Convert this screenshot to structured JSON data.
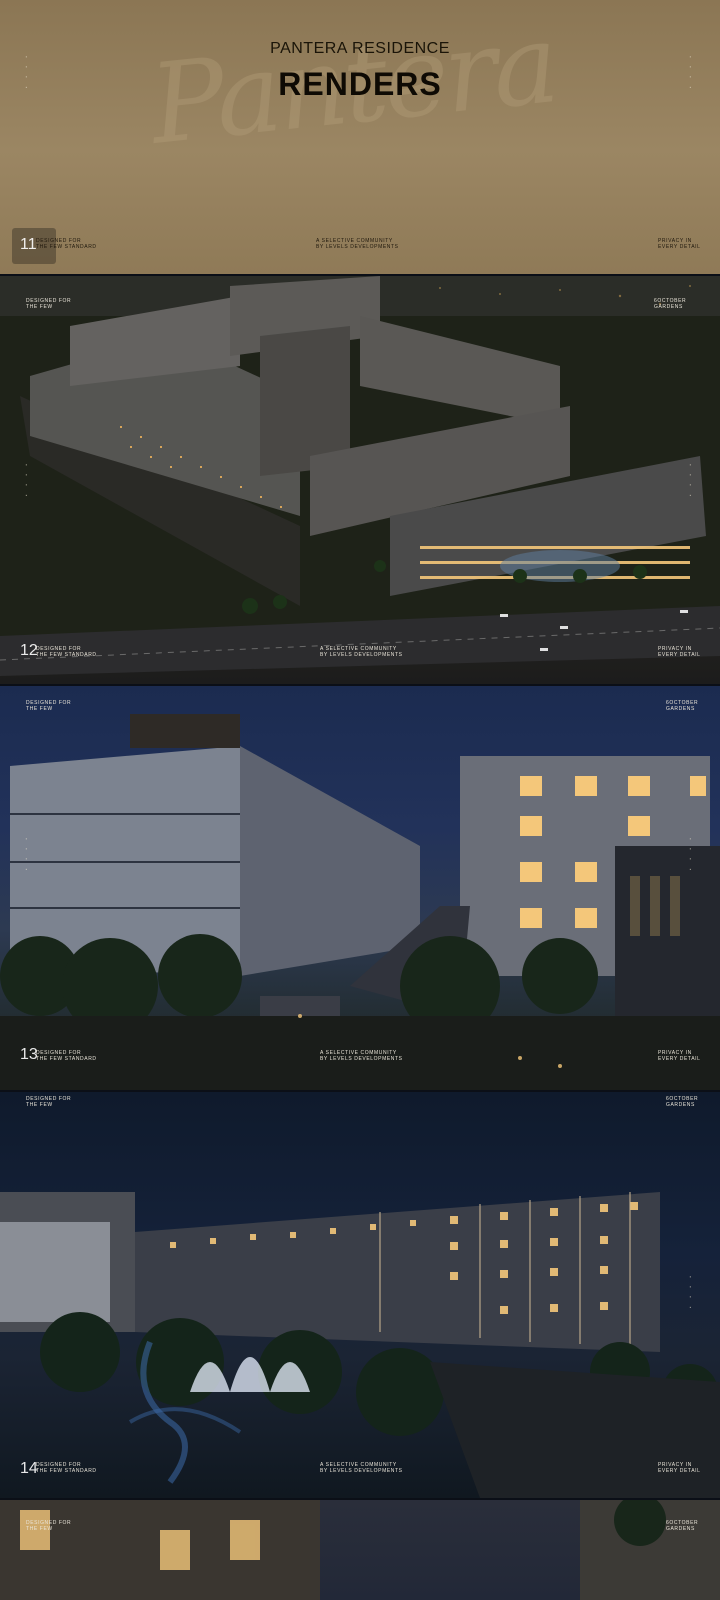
{
  "cover": {
    "subtitle": "PANTERA RESIDENCE",
    "title": "RENDERS",
    "script_text": "Pantera",
    "page_number": "11",
    "left_caption": "DESIGNED FOR\nTHE FEW STANDARD",
    "center_caption": "A SELECTIVE COMMUNITY\nBY LEVELS DEVELOPMENTS",
    "right_caption": "PRIVACY IN\nEVERY DETAIL"
  },
  "pages": [
    {
      "page_number": "12",
      "top_left": "DESIGNED FOR\nTHE FEW",
      "top_right": "6OCTOBER\nGARDENS",
      "bottom_left": "DESIGNED FOR\nTHE FEW STANDARD",
      "bottom_center": "A SELECTIVE COMMUNITY\nBY LEVELS DEVELOPMENTS",
      "bottom_right": "PRIVACY IN\nEVERY DETAIL"
    },
    {
      "page_number": "13",
      "top_left": "DESIGNED FOR\nTHE FEW",
      "top_right": "6OCTOBER\nGARDENS",
      "bottom_left": "DESIGNED FOR\nTHE FEW STANDARD",
      "bottom_center": "A SELECTIVE COMMUNITY\nBY LEVELS DEVELOPMENTS",
      "bottom_right": "PRIVACY IN\nEVERY DETAIL"
    },
    {
      "page_number": "14",
      "top_left": "DESIGNED FOR\nTHE FEW",
      "top_right": "6OCTOBER\nGARDENS",
      "bottom_left": "DESIGNED FOR\nTHE FEW STANDARD",
      "bottom_center": "A SELECTIVE COMMUNITY\nBY LEVELS DEVELOPMENTS",
      "bottom_right": "PRIVACY IN\nEVERY DETAIL"
    },
    {
      "top_left": "DESIGNED FOR\nTHE FEW",
      "top_right": "6OCTOBER\nGARDENS"
    }
  ],
  "colors": {
    "cover_gold": "#9b8663",
    "title_dark": "#0e0a04",
    "window_glow": "#f4c77a",
    "night_blue": "#1b2b50"
  }
}
